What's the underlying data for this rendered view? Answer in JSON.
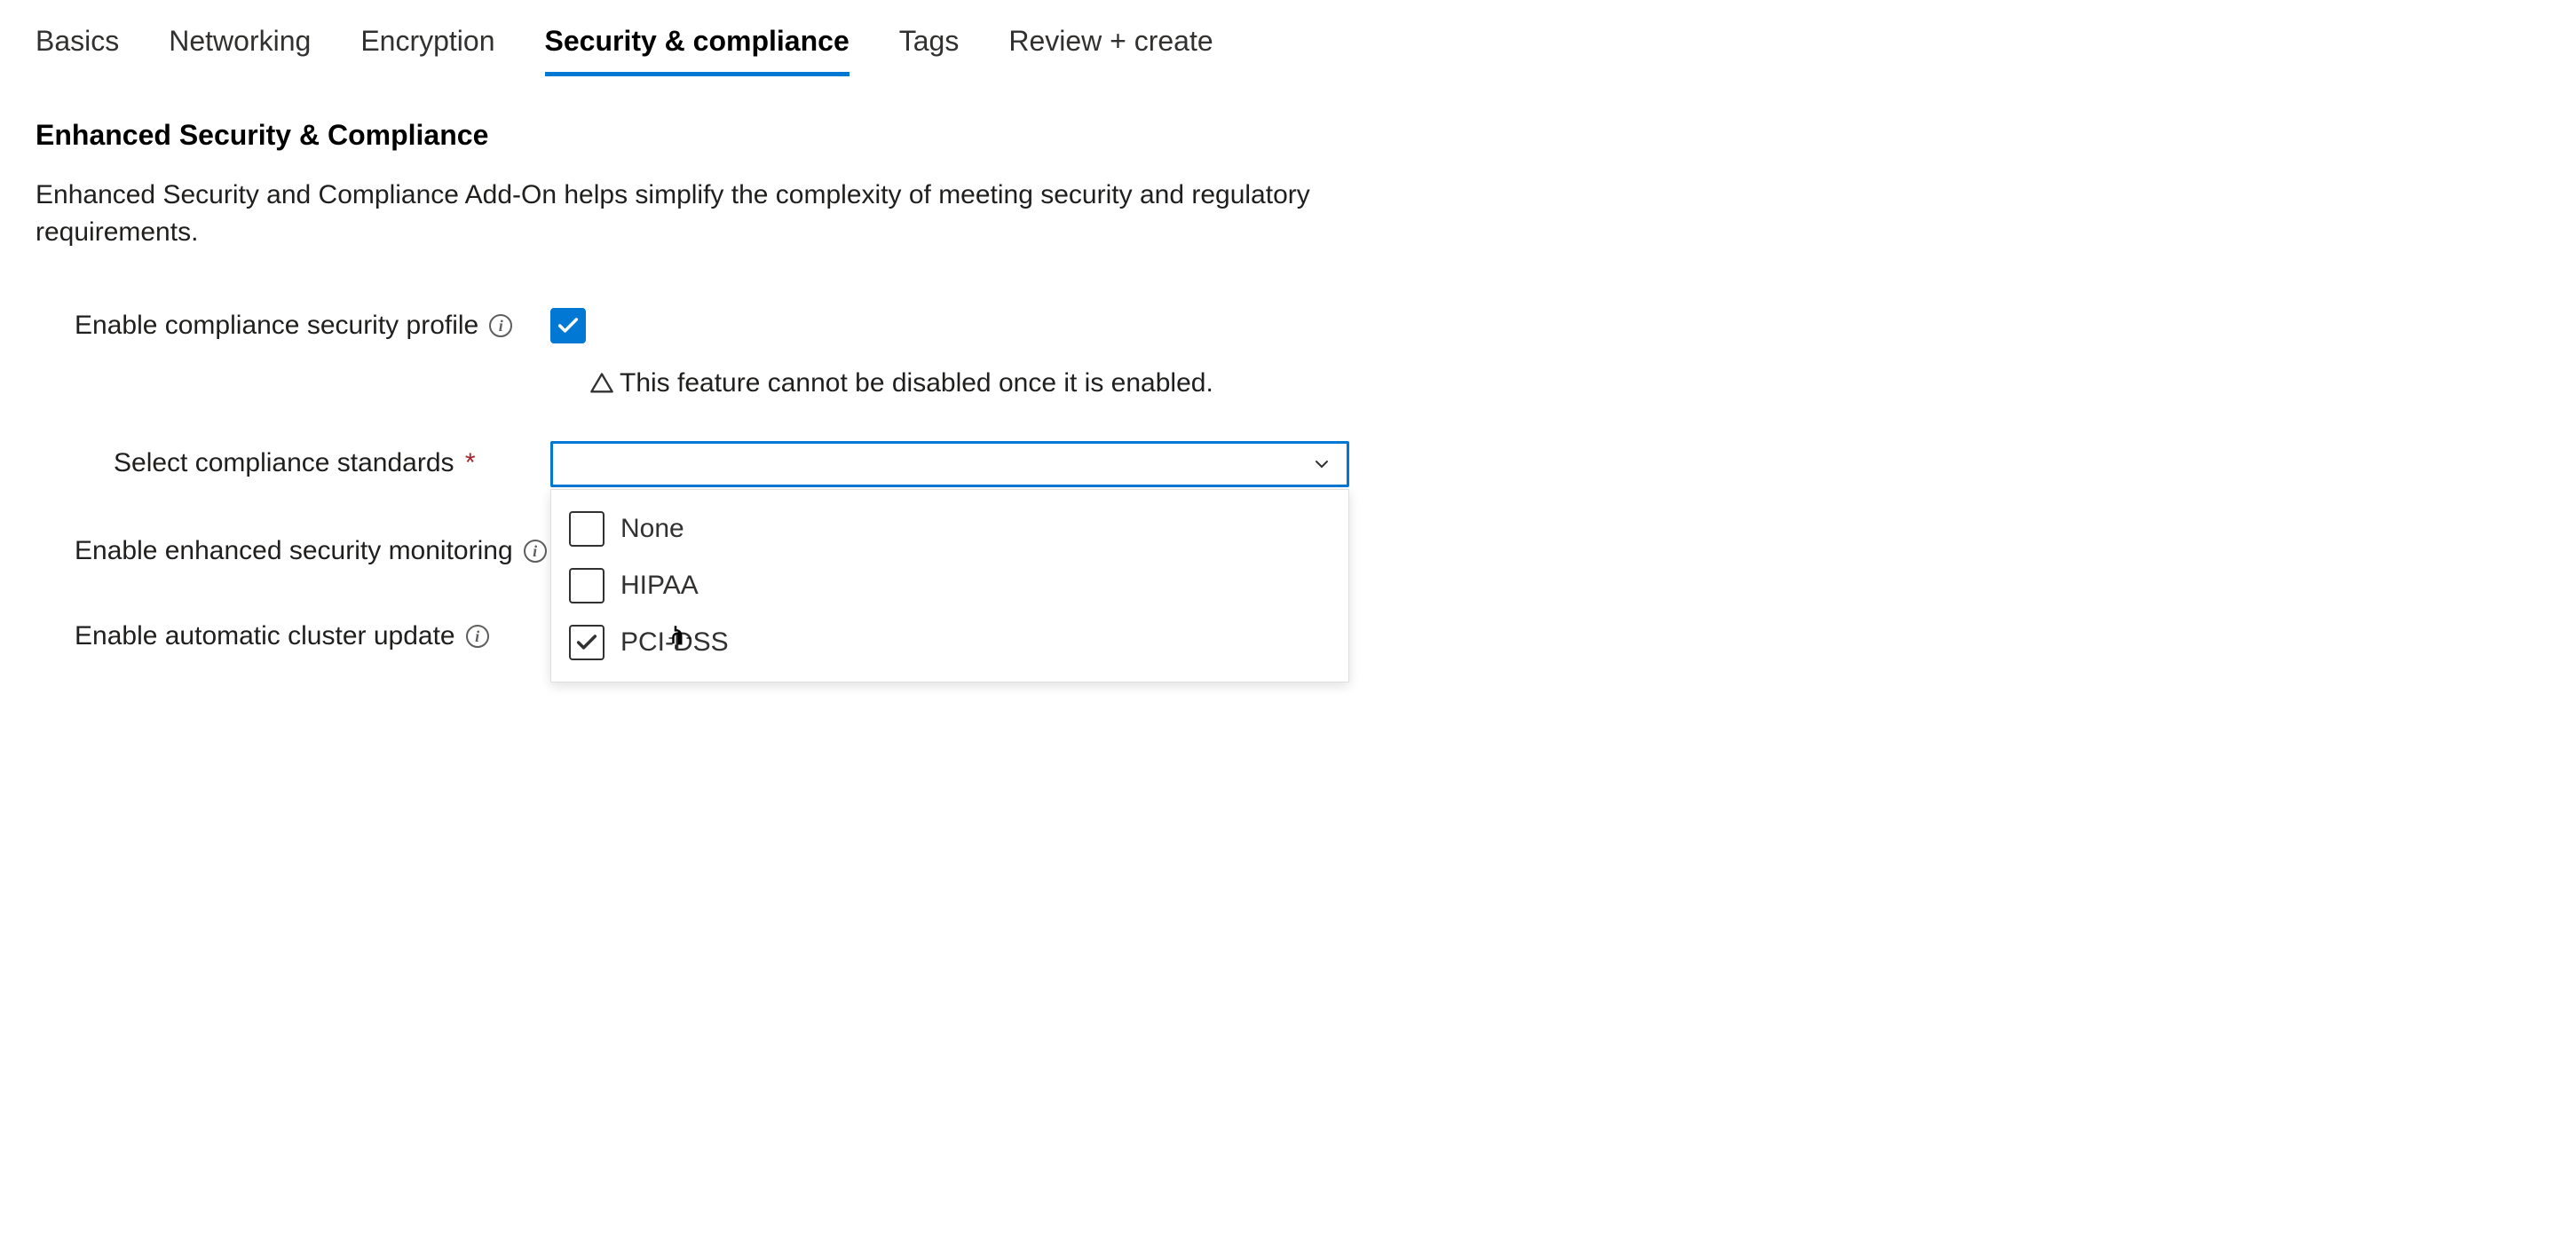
{
  "tabs": [
    {
      "label": "Basics",
      "active": false
    },
    {
      "label": "Networking",
      "active": false
    },
    {
      "label": "Encryption",
      "active": false
    },
    {
      "label": "Security & compliance",
      "active": true
    },
    {
      "label": "Tags",
      "active": false
    },
    {
      "label": "Review + create",
      "active": false
    }
  ],
  "section": {
    "title": "Enhanced Security & Compliance",
    "description": "Enhanced Security and Compliance Add-On helps simplify the complexity of meeting security and regulatory requirements."
  },
  "fields": {
    "enable_profile": {
      "label": "Enable compliance security profile",
      "checked": true,
      "warning": "This feature cannot be disabled once it is enabled."
    },
    "compliance_standards": {
      "label": "Select compliance standards",
      "required": true,
      "value": "",
      "options": [
        {
          "label": "None",
          "checked": false
        },
        {
          "label": "HIPAA",
          "checked": false
        },
        {
          "label": "PCI-DSS",
          "checked": true
        }
      ]
    },
    "enhanced_monitoring": {
      "label": "Enable enhanced security monitoring",
      "checked": true,
      "disabled": true
    },
    "auto_cluster_update": {
      "label": "Enable automatic cluster update",
      "checked": true,
      "disabled": true
    }
  }
}
